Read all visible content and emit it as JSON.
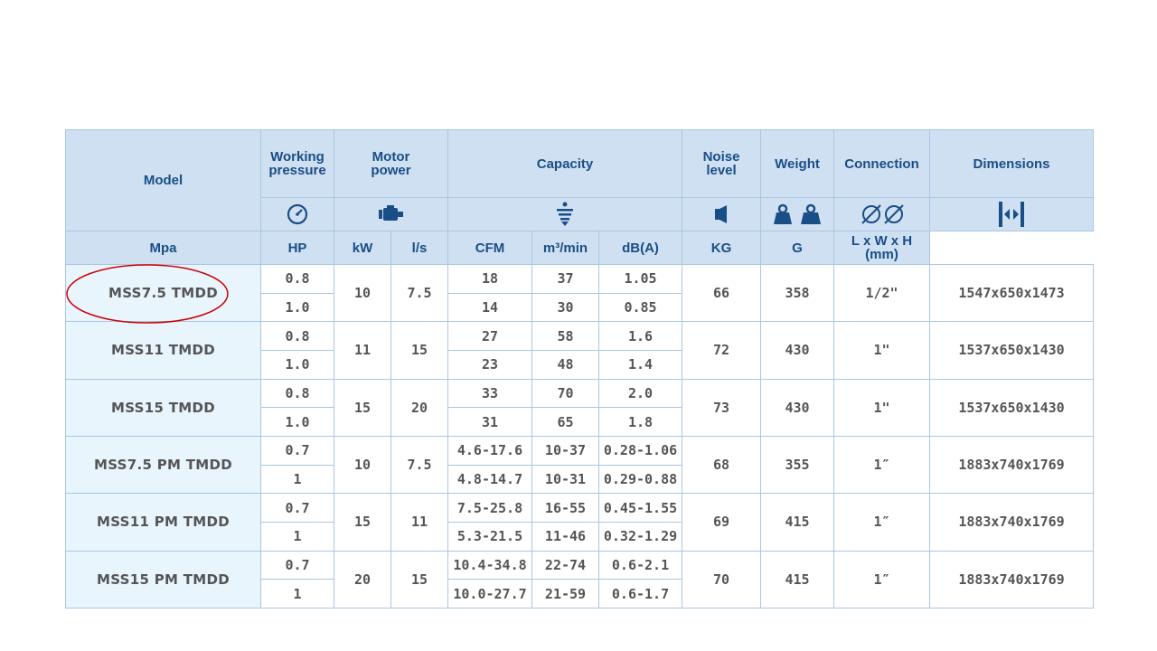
{
  "headers": {
    "model": "Model",
    "working_pressure": "Working pressure",
    "motor_power": "Motor power",
    "capacity": "Capacity",
    "noise_level": "Noise level",
    "weight": "Weight",
    "connection": "Connection",
    "dimensions": "Dimensions"
  },
  "icons": {
    "pressure": "gauge-icon",
    "motor": "motor-icon",
    "capacity": "flow-icon",
    "noise": "speaker-icon",
    "weight": "weights-icon",
    "connection": "pipe-thread-icon",
    "dimensions": "width-arrows-icon"
  },
  "units": [
    "Mpa",
    "HP",
    "kW",
    "l/s",
    "CFM",
    "m³/min",
    "dB(A)",
    "KG",
    "G",
    "L x W x H (mm)"
  ],
  "colors": {
    "header_bg": "#cfe0f2",
    "header_text": "#1a4e86",
    "model_bg": "#e8f5fd",
    "border": "#a9c6e2",
    "highlight": "#cc0000"
  },
  "rows": [
    {
      "model": "MSS7.5 TMDD",
      "hp": "10",
      "kw": "7.5",
      "noise": "66",
      "weight": "358",
      "connection": "1/2\"",
      "dimensions": "1547x650x1473",
      "sub": [
        {
          "mpa": "0.8",
          "ls": "18",
          "cfm": "37",
          "m3": "1.05"
        },
        {
          "mpa": "1.0",
          "ls": "14",
          "cfm": "30",
          "m3": "0.85"
        }
      ]
    },
    {
      "model": "MSS11 TMDD",
      "hp": "11",
      "kw": "15",
      "noise": "72",
      "weight": "430",
      "connection": "1\"",
      "dimensions": "1537x650x1430",
      "sub": [
        {
          "mpa": "0.8",
          "ls": "27",
          "cfm": "58",
          "m3": "1.6"
        },
        {
          "mpa": "1.0",
          "ls": "23",
          "cfm": "48",
          "m3": "1.4"
        }
      ]
    },
    {
      "model": "MSS15 TMDD",
      "hp": "15",
      "kw": "20",
      "noise": "73",
      "weight": "430",
      "connection": "1\"",
      "dimensions": "1537x650x1430",
      "sub": [
        {
          "mpa": "0.8",
          "ls": "33",
          "cfm": "70",
          "m3": "2.0"
        },
        {
          "mpa": "1.0",
          "ls": "31",
          "cfm": "65",
          "m3": "1.8"
        }
      ]
    },
    {
      "model": "MSS7.5 PM TMDD",
      "hp": "10",
      "kw": "7.5",
      "noise": "68",
      "weight": "355",
      "connection": "1″",
      "dimensions": "1883x740x1769",
      "sub": [
        {
          "mpa": "0.7",
          "ls": "4.6-17.6",
          "cfm": "10-37",
          "m3": "0.28-1.06"
        },
        {
          "mpa": "1",
          "ls": "4.8-14.7",
          "cfm": "10-31",
          "m3": "0.29-0.88"
        }
      ]
    },
    {
      "model": "MSS11 PM TMDD",
      "hp": "15",
      "kw": "11",
      "noise": "69",
      "weight": "415",
      "connection": "1″",
      "dimensions": "1883x740x1769",
      "sub": [
        {
          "mpa": "0.7",
          "ls": "7.5-25.8",
          "cfm": "16-55",
          "m3": "0.45-1.55"
        },
        {
          "mpa": "1",
          "ls": "5.3-21.5",
          "cfm": "11-46",
          "m3": "0.32-1.29"
        }
      ]
    },
    {
      "model": "MSS15 PM TMDD",
      "hp": "20",
      "kw": "15",
      "noise": "70",
      "weight": "415",
      "connection": "1″",
      "dimensions": "1883x740x1769",
      "sub": [
        {
          "mpa": "0.7",
          "ls": "10.4-34.8",
          "cfm": "22-74",
          "m3": "0.6-2.1"
        },
        {
          "mpa": "1",
          "ls": "10.0-27.7",
          "cfm": "21-59",
          "m3": "0.6-1.7"
        }
      ]
    }
  ],
  "highlighted_model": "MSS7.5 TMDD"
}
